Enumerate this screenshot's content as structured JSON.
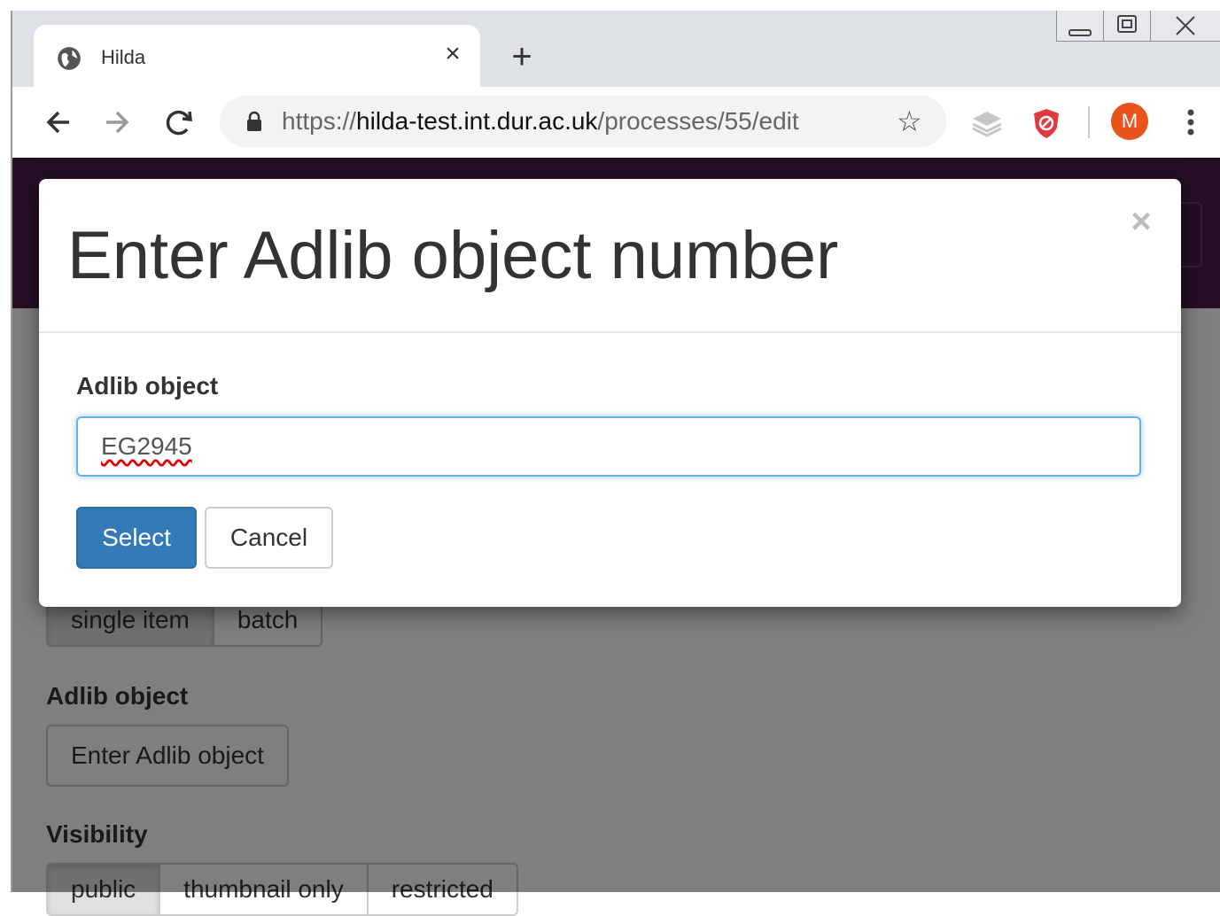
{
  "browser": {
    "tab_title": "Hilda",
    "url_scheme": "https://",
    "url_host": "hilda-test.int.dur.ac.uk",
    "url_path": "/processes/55/edit",
    "avatar_letter": "M"
  },
  "page": {
    "type_options": [
      "single item",
      "batch"
    ],
    "adlib_label": "Adlib object",
    "adlib_button": "Enter Adlib object",
    "visibility_label": "Visibility",
    "visibility_options": [
      "public",
      "thumbnail only",
      "restricted"
    ]
  },
  "modal": {
    "title": "Enter Adlib object number",
    "close_symbol": "×",
    "field_label": "Adlib object",
    "field_value": "EG2945",
    "select_label": "Select",
    "cancel_label": "Cancel"
  },
  "colors": {
    "navbar": "#4a1e4b",
    "primary": "#337ab7",
    "avatar": "#e8541c"
  }
}
